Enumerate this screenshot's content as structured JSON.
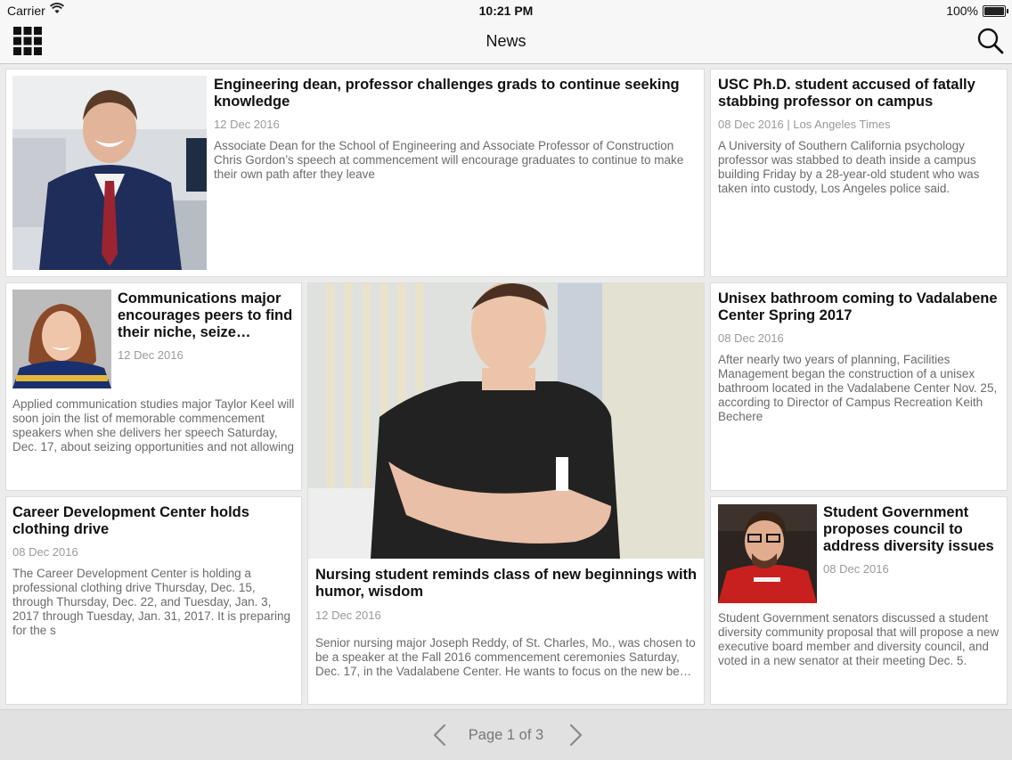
{
  "status_bar": {
    "carrier": "Carrier",
    "time": "10:21 PM",
    "battery": "100%"
  },
  "nav": {
    "title": "News",
    "left_icon": "grid-icon",
    "right_icon": "search-icon"
  },
  "articles": [
    {
      "title": "Engineering dean, professor challenges grads to continue seeking knowledge",
      "date": "12 Dec 2016",
      "summary": "Associate Dean for the School of Engineering and Associate Professor of Construction Chris Gordon’s speech at commencement will encourage graduates to continue to make their own path after they leave"
    },
    {
      "title": "USC Ph.D. student accused of fatally stabbing professor on campus",
      "date": "08 Dec 2016 | Los Angeles Times",
      "summary": "A University of Southern California psychology professor was stabbed to death inside a campus building Friday by a 28-year-old student who was taken into custody, Los Angeles police said."
    },
    {
      "title": "Communications major encourages peers  to find their niche, seize…",
      "date": "12 Dec 2016",
      "summary": "Applied communication studies major Taylor Keel will soon join the list of memorable commencement speakers when she delivers her speech Saturday, Dec. 17, about seizing opportunities and not allowing"
    },
    {
      "title": "Nursing student reminds class of new beginnings with humor, wisdom",
      "date": "12 Dec 2016",
      "summary": "Senior nursing major Joseph Reddy, of St. Charles, Mo., was chosen to be a speaker at the Fall 2016 commencement ceremonies Saturday, Dec. 17, in the Vadalabene Center. He wants to focus on the new be…"
    },
    {
      "title": "Unisex bathroom coming to Vadalabene Center Spring 2017",
      "date": "08 Dec 2016",
      "summary": "After nearly two years of planning, Facilities Management began the construction of a unisex bathroom located in the Vadalabene Center Nov. 25, according to Director of Campus Recreation Keith Bechere"
    },
    {
      "title": "Career Development Center holds clothing drive",
      "date": "08 Dec 2016",
      "summary": "The Career Development Center is holding a professional clothing drive Thursday, Dec. 15, through Thursday, Dec. 22, and Tuesday, Jan. 3, 2017 through Tuesday, Jan. 31, 2017. It is preparing for the s"
    },
    {
      "title": "Student Government proposes council to address diversity issues",
      "date": "08 Dec 2016",
      "summary": "Student Government senators discussed a student diversity community proposal that will propose a new executive board member and diversity council, and voted in a new senator at their meeting Dec. 5."
    }
  ],
  "pagination": {
    "label": "Page 1 of 3",
    "prev_icon": "chevron-left-icon",
    "next_icon": "chevron-right-icon"
  }
}
